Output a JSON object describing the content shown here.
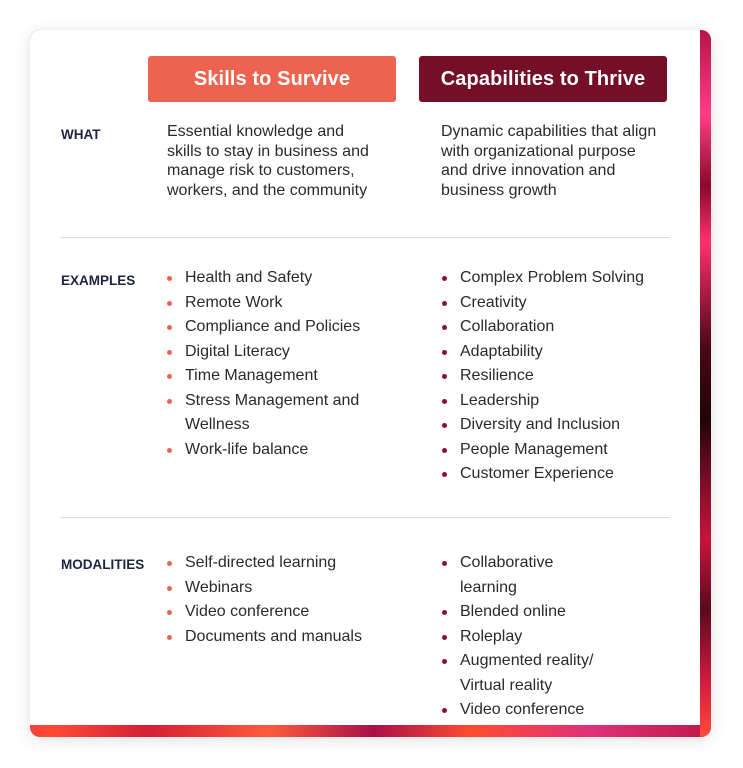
{
  "colors": {
    "survive_accent": "#ec6450",
    "thrive_accent": "#740f27",
    "label_text": "#1e2440",
    "body_text": "#2a2a2a"
  },
  "columns": {
    "survive": {
      "title": "Skills to Survive"
    },
    "thrive": {
      "title": "Capabilities to Thrive"
    }
  },
  "rows": {
    "what": {
      "label": "WHAT",
      "survive": "Essential knowledge and skills to stay in business and manage risk to customers, workers, and the community",
      "thrive": "Dynamic capabilities that align with organizational purpose and drive innovation and business growth"
    },
    "examples": {
      "label": "EXAMPLES",
      "survive": [
        "Health and Safety",
        "Remote Work",
        "Compliance and Policies",
        "Digital Literacy",
        "Time Management",
        "Stress Management and Wellness",
        "Work-life balance"
      ],
      "thrive": [
        "Complex Problem Solving",
        "Creativity",
        "Collaboration",
        "Adaptability",
        "Resilience",
        "Leadership",
        "Diversity and Inclusion",
        "People Management",
        "Customer Experience"
      ]
    },
    "modalities": {
      "label": "MODALITIES",
      "survive": [
        "Self-directed learning",
        "Webinars",
        "Video conference",
        "Documents and manuals"
      ],
      "thrive": [
        "Collaborative learning",
        "Blended online",
        "Roleplay",
        "Augmented reality/ Virtual reality",
        "Video conference"
      ]
    }
  }
}
